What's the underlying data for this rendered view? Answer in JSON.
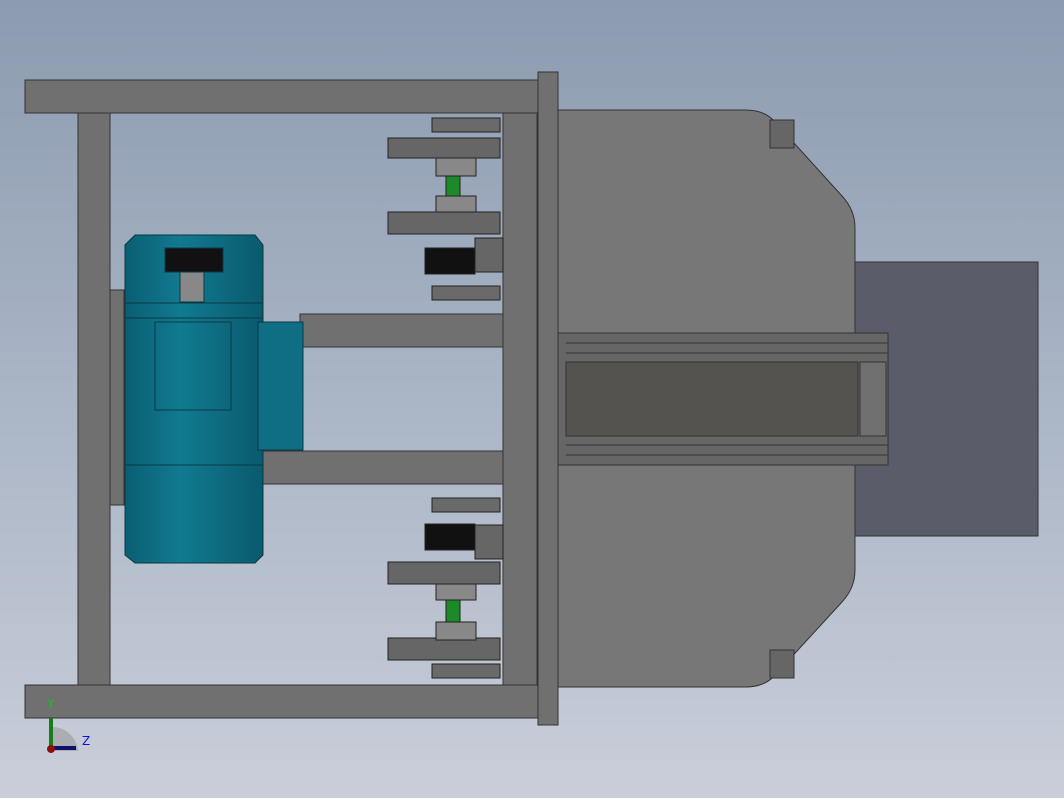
{
  "viewport": {
    "triad": {
      "y_label": "Y",
      "z_label": "Z"
    },
    "colors": {
      "frame": "#6f6f6f",
      "motor": "#0b6a80",
      "shaft": "#1d8a2a",
      "housing": "#777777",
      "plate": "#5a5c6a"
    }
  }
}
